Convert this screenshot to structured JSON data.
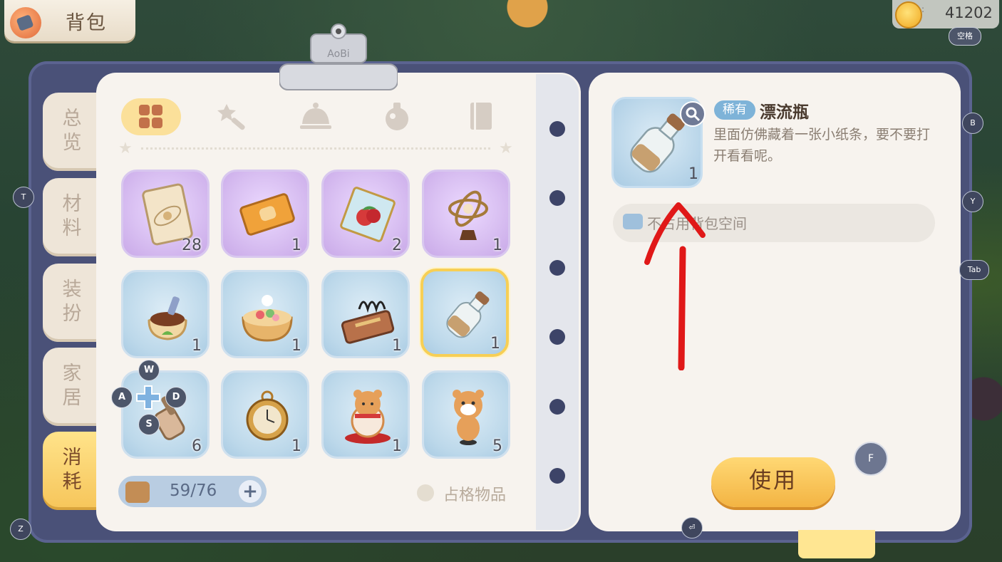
{
  "header": {
    "title": "背包",
    "title_icon": "backpack-icon"
  },
  "currency": {
    "value": "41202",
    "key_hint": "空格",
    "icon": "gold-coin-icon"
  },
  "side_tabs": [
    {
      "label": "总览",
      "active": false
    },
    {
      "label": "材料",
      "active": false
    },
    {
      "label": "装扮",
      "active": false
    },
    {
      "label": "家居",
      "active": false
    },
    {
      "label": "消耗",
      "active": true
    }
  ],
  "clip_label": "AoBi",
  "categories": [
    "grid-icon",
    "magic-wand-icon",
    "service-bell-icon",
    "potion-icon",
    "book-icon"
  ],
  "items": [
    {
      "name": "star-ticket",
      "qty": "28",
      "rarity": "purple"
    },
    {
      "name": "bread-ticket",
      "qty": "1",
      "rarity": "purple"
    },
    {
      "name": "fruit-card",
      "qty": "2",
      "rarity": "purple"
    },
    {
      "name": "armillary-sphere",
      "qty": "1",
      "rarity": "purple"
    },
    {
      "name": "soil-bag",
      "qty": "1",
      "rarity": "blue"
    },
    {
      "name": "food-bowl",
      "qty": "1",
      "rarity": "blue"
    },
    {
      "name": "coil-device",
      "qty": "1",
      "rarity": "blue"
    },
    {
      "name": "drift-bottle",
      "qty": "1",
      "rarity": "blue",
      "selected": true
    },
    {
      "name": "brush",
      "qty": "6",
      "rarity": "blue"
    },
    {
      "name": "pocket-watch",
      "qty": "1",
      "rarity": "blue"
    },
    {
      "name": "hamster-lucky",
      "qty": "1",
      "rarity": "blue"
    },
    {
      "name": "hamster-figure",
      "qty": "5",
      "rarity": "blue"
    }
  ],
  "capacity": {
    "text": "59/76",
    "plus": "+"
  },
  "occupy_filter": {
    "label": "占格物品"
  },
  "wasd": {
    "w": "W",
    "a": "A",
    "s": "S",
    "d": "D"
  },
  "detail": {
    "rarity": "稀有",
    "name": "漂流瓶",
    "description": "里面仿佛藏着一张小纸条，要不要打开看看呢。",
    "qty": "1",
    "storage_note": "不占用背包空间",
    "use_label": "使用"
  },
  "key_hints": {
    "t": "T",
    "z": "Z",
    "b": "B",
    "y": "Y",
    "tab": "Tab",
    "f": "F",
    "enter": "⏎"
  },
  "colors": {
    "frame": "#4a5178",
    "accent": "#f6c55a",
    "annotation": "#e01818"
  }
}
